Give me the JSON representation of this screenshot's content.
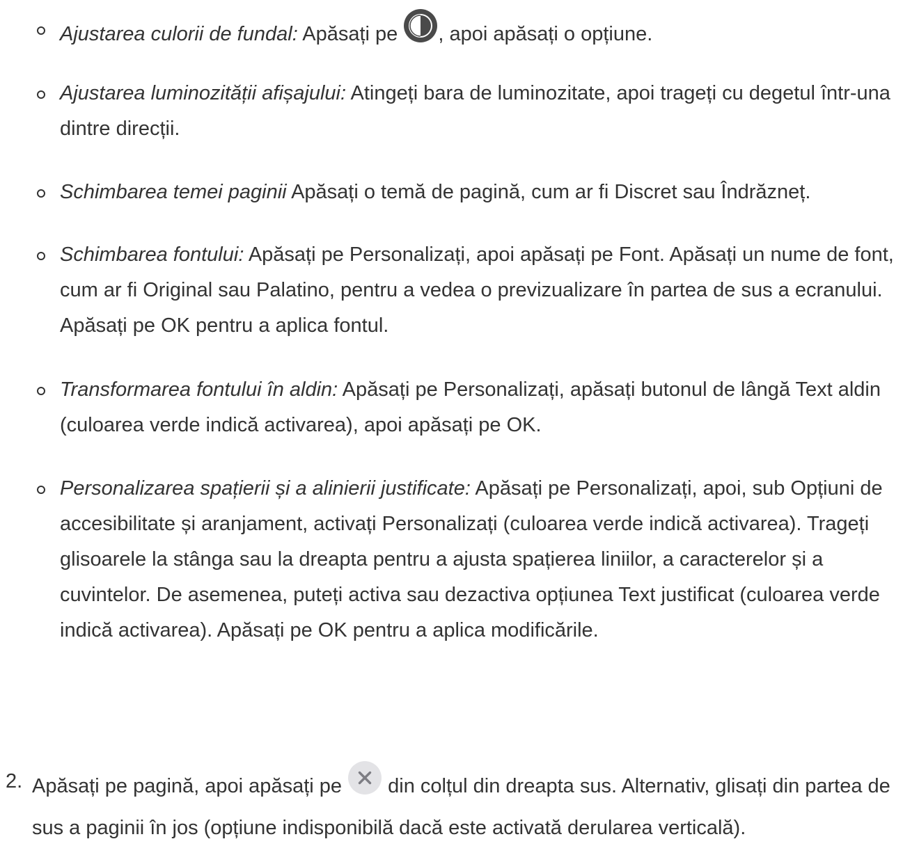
{
  "bullets": [
    {
      "title": "Ajustarea culorii de fundal:",
      "text_before": " Apăsați pe ",
      "icon": "appearance-contrast-icon",
      "text_after": ", apoi apăsați o opțiune."
    },
    {
      "title": "Ajustarea luminozității afișajului:",
      "text": " Atingeți bara de luminozitate, apoi trageți cu degetul într-una dintre direcții."
    },
    {
      "title": "Schimbarea temei paginii",
      "text": " Apăsați o temă de pagină, cum ar fi Discret sau Îndrăzneț."
    },
    {
      "title": "Schimbarea fontului:",
      "text": " Apăsați pe Personalizați, apoi apăsați pe Font. Apăsați un nume de font, cum ar fi Original sau Palatino, pentru a vedea o previzualizare în partea de sus a ecranului. Apăsați pe OK pentru a aplica fontul."
    },
    {
      "title": "Transformarea fontului în aldin:",
      "text": " Apăsați pe Personalizați, apăsați butonul de lângă Text aldin (culoarea verde indică activarea), apoi apăsați pe OK."
    },
    {
      "title": "Personalizarea spațierii și a alinierii justificate:",
      "text": " Apăsați pe Personalizați, apoi, sub Opțiuni de accesibilitate și aranjament, activați Personalizați (culoarea verde indică activarea). Trageți glisoarele la stânga sau la dreapta pentru a ajusta spațierea liniilor, a caracterelor și a cuvintelor. De asemenea, puteți activa sau dezactiva opțiunea Text justificat (culoarea verde indică activarea). Apăsați pe OK pentru a aplica modificările."
    }
  ],
  "step2": {
    "number": "2.",
    "text_before": "Apăsați pe pagină, apoi apăsați pe ",
    "icon": "close-icon",
    "text_after": " din colțul din dreapta sus. Alternativ, glisați din partea de sus a paginii în jos (opțiune indisponibilă dacă este activată derularea verticală)."
  }
}
